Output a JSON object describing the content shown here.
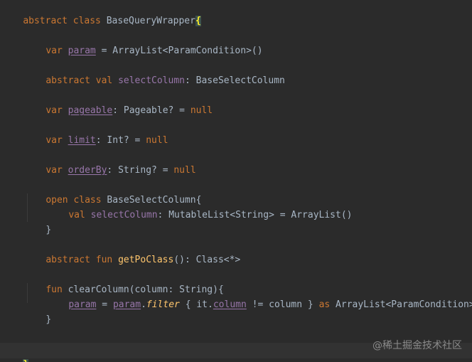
{
  "editor": {
    "language": "Kotlin",
    "theme_colors": {
      "background": "#2b2b2b",
      "keyword": "#cc7832",
      "property": "#9876aa",
      "function": "#ffc66d",
      "text": "#a9b7c6",
      "brace_highlight": "#ffef28"
    }
  },
  "code": {
    "l1": {
      "t0": "abstract class ",
      "t1": "BaseQueryWrapper",
      "t2": "{"
    },
    "l2": {
      "t0": "var ",
      "t1": "param",
      "t2": " = ArrayList<ParamCondition>()"
    },
    "l3": {
      "t0": "abstract val ",
      "t1": "selectColumn",
      "t2": ": BaseSelectColumn"
    },
    "l4": {
      "t0": "var ",
      "t1": "pageable",
      "t2": ": Pageable? = ",
      "t3": "null"
    },
    "l5": {
      "t0": "var ",
      "t1": "limit",
      "t2": ": Int? = ",
      "t3": "null"
    },
    "l6": {
      "t0": "var ",
      "t1": "orderBy",
      "t2": ": String? = ",
      "t3": "null"
    },
    "l7": {
      "t0": "open class ",
      "t1": "BaseSelectColumn{"
    },
    "l8": {
      "t0": "val ",
      "t1": "selectColumn",
      "t2": ": MutableList<String> = ArrayList()"
    },
    "l9": {
      "t0": "}"
    },
    "l10": {
      "t0": "abstract fun ",
      "t1": "getPoClass",
      "t2": "(): Class<*>"
    },
    "l11": {
      "t0": "fun ",
      "t1": "clearColumn",
      "t2": "(column: String){"
    },
    "l12": {
      "t0": "param",
      "t1": " = ",
      "t2": "param",
      "t3": ".",
      "t4": "filter",
      "t5": " { it.",
      "t6": "column",
      "t7": " != column } ",
      "t8": "as",
      "t9": " ArrayList<ParamCondition>"
    },
    "l13": {
      "t0": "}"
    },
    "l14": {
      "t0": "}"
    }
  },
  "watermark": "@稀土掘金技术社区"
}
